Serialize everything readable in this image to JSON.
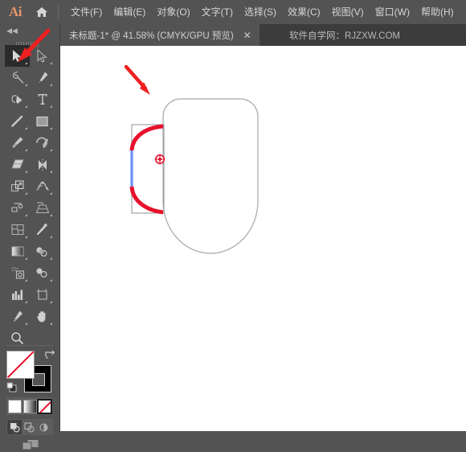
{
  "app": {
    "logo_text": "Ai",
    "home_icon": "home-icon"
  },
  "menubar": {
    "items": [
      {
        "label": "文件(F)",
        "name": "menu-file"
      },
      {
        "label": "编辑(E)",
        "name": "menu-edit"
      },
      {
        "label": "对象(O)",
        "name": "menu-object"
      },
      {
        "label": "文字(T)",
        "name": "menu-type"
      },
      {
        "label": "选择(S)",
        "name": "menu-select"
      },
      {
        "label": "效果(C)",
        "name": "menu-effect"
      },
      {
        "label": "视图(V)",
        "name": "menu-view"
      },
      {
        "label": "窗口(W)",
        "name": "menu-window"
      },
      {
        "label": "帮助(H)",
        "name": "menu-help"
      }
    ]
  },
  "tabs": {
    "active": {
      "title": "未标题-1* @ 41.58% (CMYK/GPU 预览)",
      "close_glyph": "✕"
    },
    "secondary": {
      "title": "软件自学网：RJZXW.COM"
    }
  },
  "toolbar": {
    "collapse_glyph": "◀◀",
    "tools": [
      {
        "name": "selection-tool",
        "label": "选择工具",
        "selected": true
      },
      {
        "name": "direct-selection-tool",
        "label": "直接选择工具",
        "selected": false
      },
      {
        "name": "magic-wand-tool",
        "label": "魔棒工具",
        "selected": false
      },
      {
        "name": "pen-tool",
        "label": "钢笔工具",
        "selected": false
      },
      {
        "name": "curvature-tool",
        "label": "曲率工具",
        "selected": false
      },
      {
        "name": "type-tool",
        "label": "文字工具",
        "selected": false
      },
      {
        "name": "line-segment-tool",
        "label": "直线段工具",
        "selected": false
      },
      {
        "name": "rectangle-tool",
        "label": "矩形工具",
        "selected": false
      },
      {
        "name": "paintbrush-tool",
        "label": "画笔工具",
        "selected": false
      },
      {
        "name": "shaper-tool",
        "label": "Shaper 工具",
        "selected": false
      },
      {
        "name": "eraser-tool",
        "label": "橡皮擦工具",
        "selected": false
      },
      {
        "name": "rotate-tool",
        "label": "旋转工具",
        "selected": false
      },
      {
        "name": "scale-tool",
        "label": "比例缩放工具",
        "selected": false
      },
      {
        "name": "width-tool",
        "label": "宽度工具",
        "selected": false
      },
      {
        "name": "free-transform-tool",
        "label": "自由变换工具",
        "selected": false
      },
      {
        "name": "shape-builder-tool",
        "label": "形状生成器工具",
        "selected": false
      },
      {
        "name": "perspective-grid-tool",
        "label": "透视网格工具",
        "selected": false
      },
      {
        "name": "mesh-tool",
        "label": "网格工具",
        "selected": false
      },
      {
        "name": "gradient-tool",
        "label": "渐变工具",
        "selected": false
      },
      {
        "name": "eyedropper-tool",
        "label": "吸管工具",
        "selected": false
      },
      {
        "name": "blend-tool",
        "label": "混合工具",
        "selected": false
      },
      {
        "name": "symbol-sprayer-tool",
        "label": "符号喷枪工具",
        "selected": false
      },
      {
        "name": "column-graph-tool",
        "label": "柱形图工具",
        "selected": false
      },
      {
        "name": "artboard-tool",
        "label": "画板工具",
        "selected": false
      },
      {
        "name": "slice-tool",
        "label": "切片工具",
        "selected": false
      },
      {
        "name": "hand-tool",
        "label": "抓手工具",
        "selected": false
      },
      {
        "name": "zoom-tool",
        "label": "缩放工具",
        "selected": false
      }
    ],
    "fill_stroke": {
      "fill_label": "填色",
      "fill_value": "无",
      "fill_color": "#ffffff",
      "stroke_label": "描边",
      "stroke_value": "黑色",
      "stroke_color": "#000000",
      "none_slash_color": "#e8112d",
      "swap_icon": "swap-fill-stroke-icon",
      "default_icon": "default-fill-stroke-icon"
    },
    "paint_modes": [
      {
        "name": "color-mode",
        "label": "颜色",
        "selected": false
      },
      {
        "name": "gradient-mode",
        "label": "渐变",
        "selected": false
      },
      {
        "name": "none-mode",
        "label": "无",
        "selected": true
      }
    ],
    "draw_modes": [
      {
        "name": "draw-normal-mode",
        "label": "正常绘图",
        "selected": true
      },
      {
        "name": "draw-behind-mode",
        "label": "背面绘图",
        "selected": false
      },
      {
        "name": "draw-inside-mode",
        "label": "内部绘图",
        "selected": false
      }
    ],
    "screen_mode": {
      "name": "change-screen-mode",
      "label": "更改屏幕模式"
    }
  },
  "canvas": {
    "background": "#ffffff",
    "artwork": {
      "name": "mug-illustration",
      "path_color": "#a8a8a8",
      "selected_path_color": "#e8112d",
      "anchor_segment_color": "#6d8ff5",
      "bounding_box_color": "#9b9b9b",
      "rotation_origin_color": "#e8112d",
      "body_label": "杯身",
      "handle_label": "杯柄"
    },
    "annotations": [
      {
        "name": "arrow-annotation-handle",
        "color": "#e8112d",
        "points_to": "杯柄圆弧"
      },
      {
        "name": "arrow-annotation-tool",
        "color": "#e8112d",
        "points_to": "选择工具"
      }
    ]
  },
  "colors": {
    "chrome": "#535353",
    "chrome_dark": "#3c3c3c",
    "tool_selected": "#2b2b2b",
    "text": "#d6d6d6",
    "accent_red": "#e8112d",
    "accent_orange": "#e8956b"
  }
}
